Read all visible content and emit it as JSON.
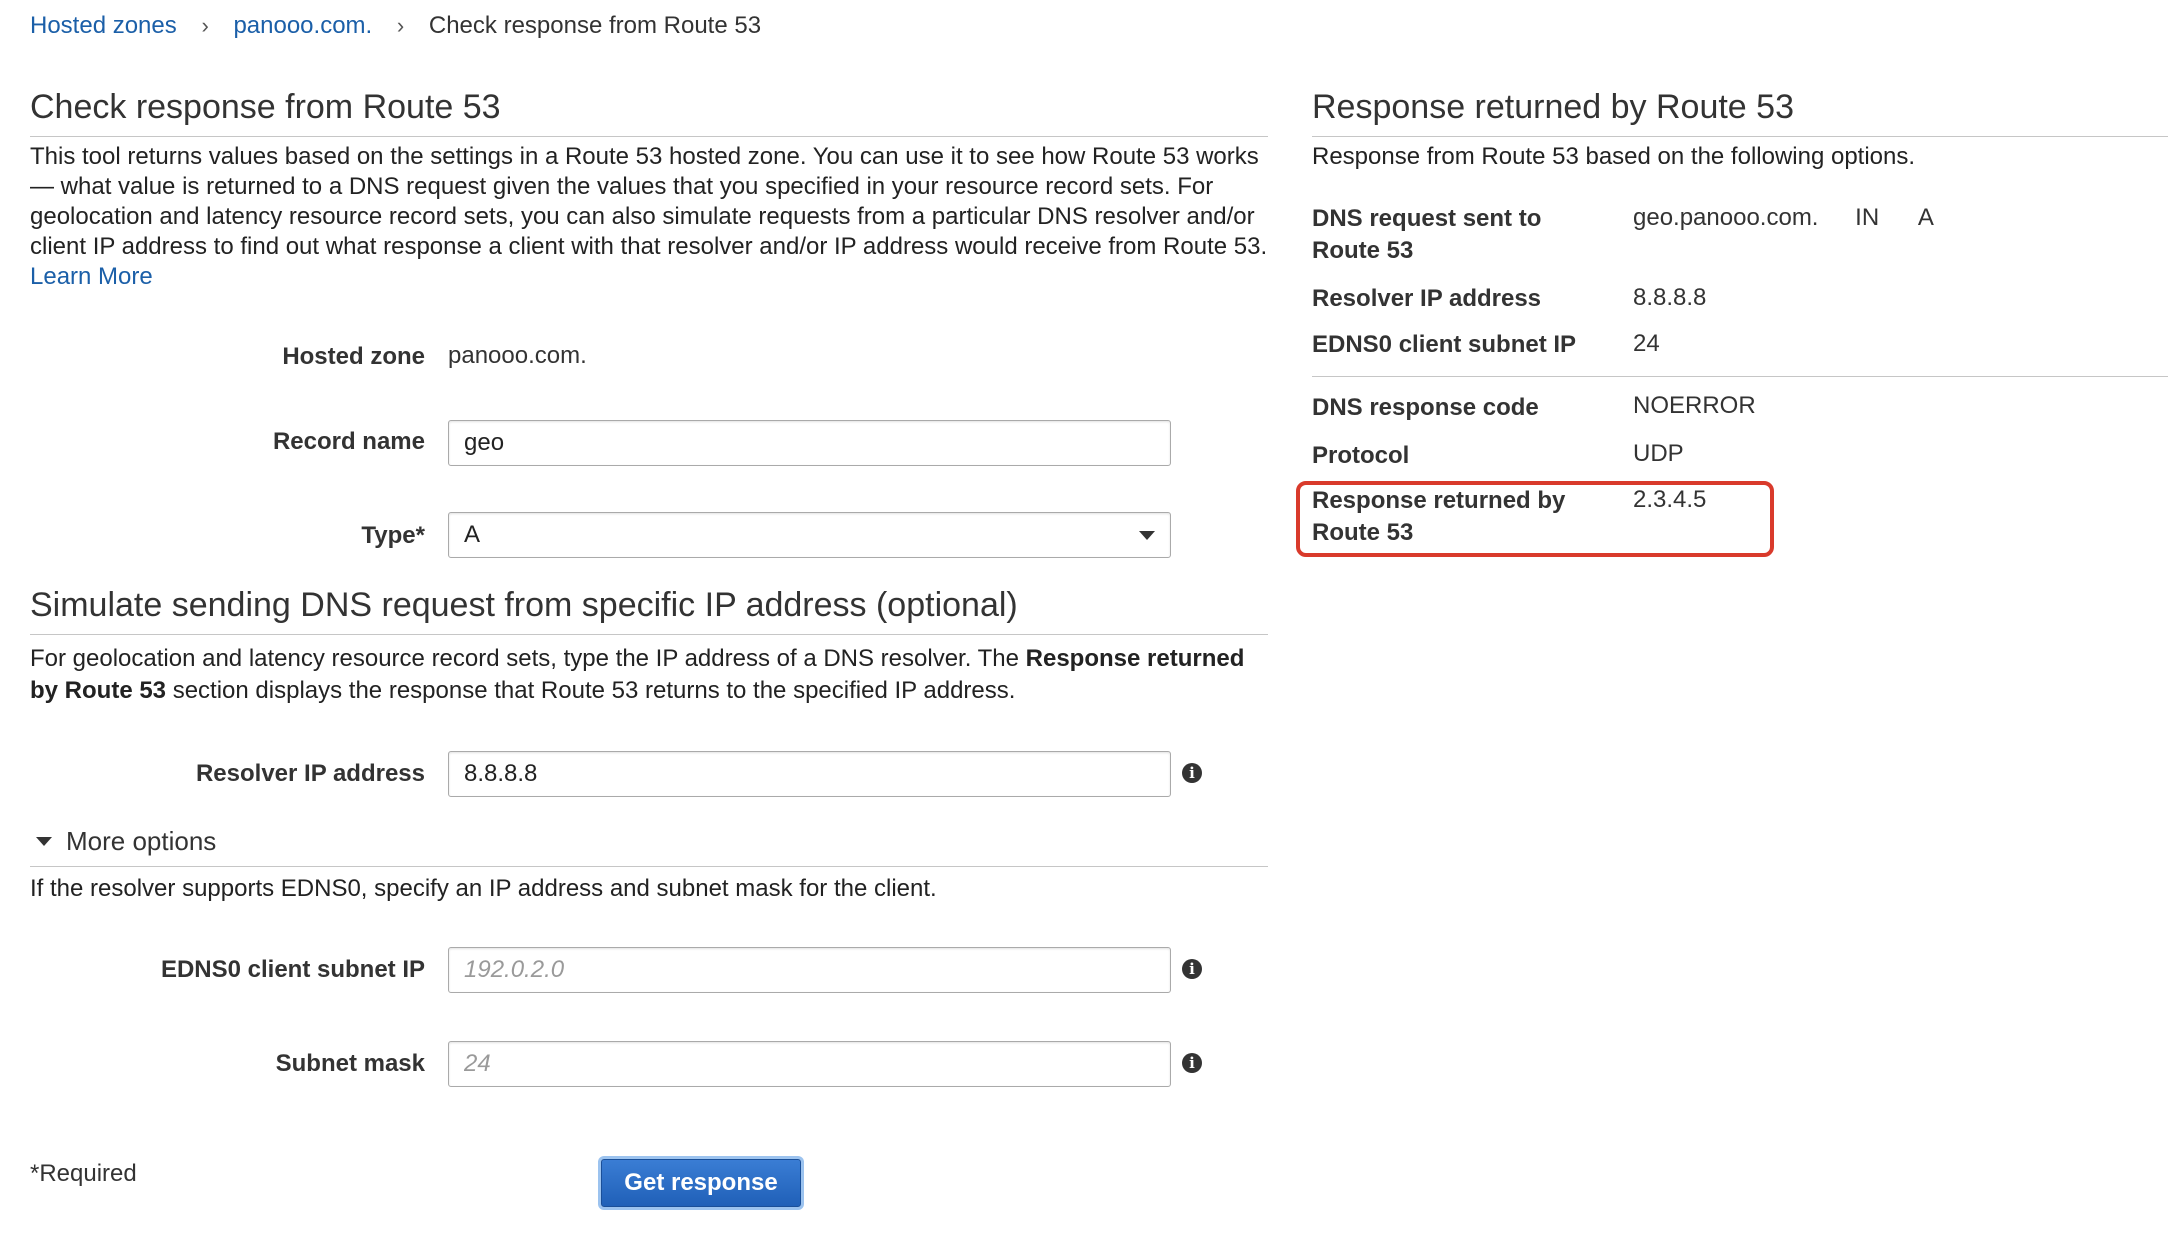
{
  "breadcrumb": {
    "items": [
      "Hosted zones",
      "panooo.com."
    ],
    "current": "Check response from Route 53"
  },
  "left": {
    "title": "Check response from Route 53",
    "intro": "This tool returns values based on the settings in a Route 53 hosted zone. You can use it to see how Route 53 works — what value is returned to a DNS request given the values that you specified in your resource record sets. For geolocation and latency resource record sets, you can also simulate requests from a particular DNS resolver and/or client IP address to find out what response a client with that resolver and/or IP address would receive from Route 53.",
    "learn_more": "Learn More",
    "hosted_zone_label": "Hosted zone",
    "hosted_zone_value": "panooo.com.",
    "record_name_label": "Record name",
    "record_name_value": "geo",
    "type_label": "Type*",
    "type_value": "A",
    "simulate_title": "Simulate sending DNS request from specific IP address (optional)",
    "simulate_text_a": "For geolocation and latency resource record sets, type the IP address of a DNS resolver. The",
    "simulate_text_bold": "Response returned by Route 53",
    "simulate_text_b": "section displays the response that Route 53 returns to the specified IP address.",
    "resolver_label": "Resolver IP address",
    "resolver_value": "8.8.8.8",
    "more_options": "More options",
    "edns_text": "If the resolver supports EDNS0, specify an IP address and subnet mask for the client.",
    "edns_label": "EDNS0 client subnet IP",
    "edns_placeholder": "192.0.2.0",
    "subnet_label": "Subnet mask",
    "subnet_placeholder": "24",
    "required": "*Required",
    "button": "Get response"
  },
  "right": {
    "title": "Response returned by Route 53",
    "subtitle": "Response from Route 53 based on the following options.",
    "dns_request_label": "DNS request sent to Route 53",
    "dns_request_name": "geo.panooo.com.",
    "dns_request_class": "IN",
    "dns_request_type": "A",
    "resolver_label": "Resolver IP address",
    "resolver_value": "8.8.8.8",
    "edns_label": "EDNS0 client subnet IP",
    "edns_value": "24",
    "response_code_label": "DNS response code",
    "response_code_value": "NOERROR",
    "protocol_label": "Protocol",
    "protocol_value": "UDP",
    "returned_label": "Response returned by Route 53",
    "returned_value": "2.3.4.5"
  },
  "colors": {
    "link": "#1b5fa8",
    "highlight": "#d93a2b",
    "button": "#2a6cc6"
  }
}
